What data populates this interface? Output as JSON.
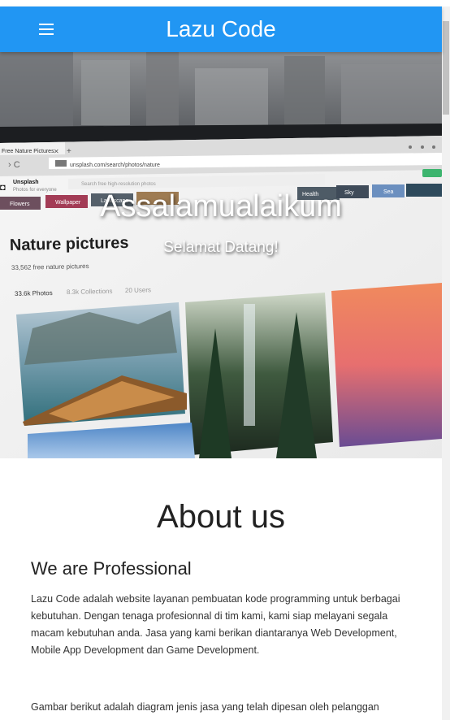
{
  "navbar": {
    "brand": "Lazu Code",
    "menu_icon": "hamburger-icon"
  },
  "hero": {
    "title": "Assalamualaikum",
    "subtitle": "Selamat Datang!",
    "screen": {
      "tab_label": "Free Nature Pictures",
      "site_name": "Unsplash",
      "site_tagline": "Photos for everyone",
      "search_placeholder": "Search free high-resolution photos",
      "page_heading": "Nature pictures",
      "page_count": "33,562 free nature pictures",
      "stats": [
        "33.6k Photos",
        "8.3k Collections",
        "20 Users"
      ],
      "chips": [
        "Flowers",
        "Wallpaper",
        "Landscape",
        "Health",
        "Sky",
        "Sea"
      ]
    }
  },
  "about": {
    "title": "About us",
    "subtitle": "We are Professional",
    "paragraph": "Lazu Code adalah website layanan pembuatan kode programming untuk berbagai kebutuhan. Dengan tenaga profesionnal di tim kami, kami siap melayani segala macam kebutuhan anda. Jasa yang kami berikan diantaranya Web Development, Mobile App Development dan Game Development.",
    "paragraph2": "Gambar berikut adalah diagram jenis jasa yang telah dipesan oleh pelanggan"
  },
  "colors": {
    "navbar": "#2196f3",
    "text": "#333333"
  }
}
